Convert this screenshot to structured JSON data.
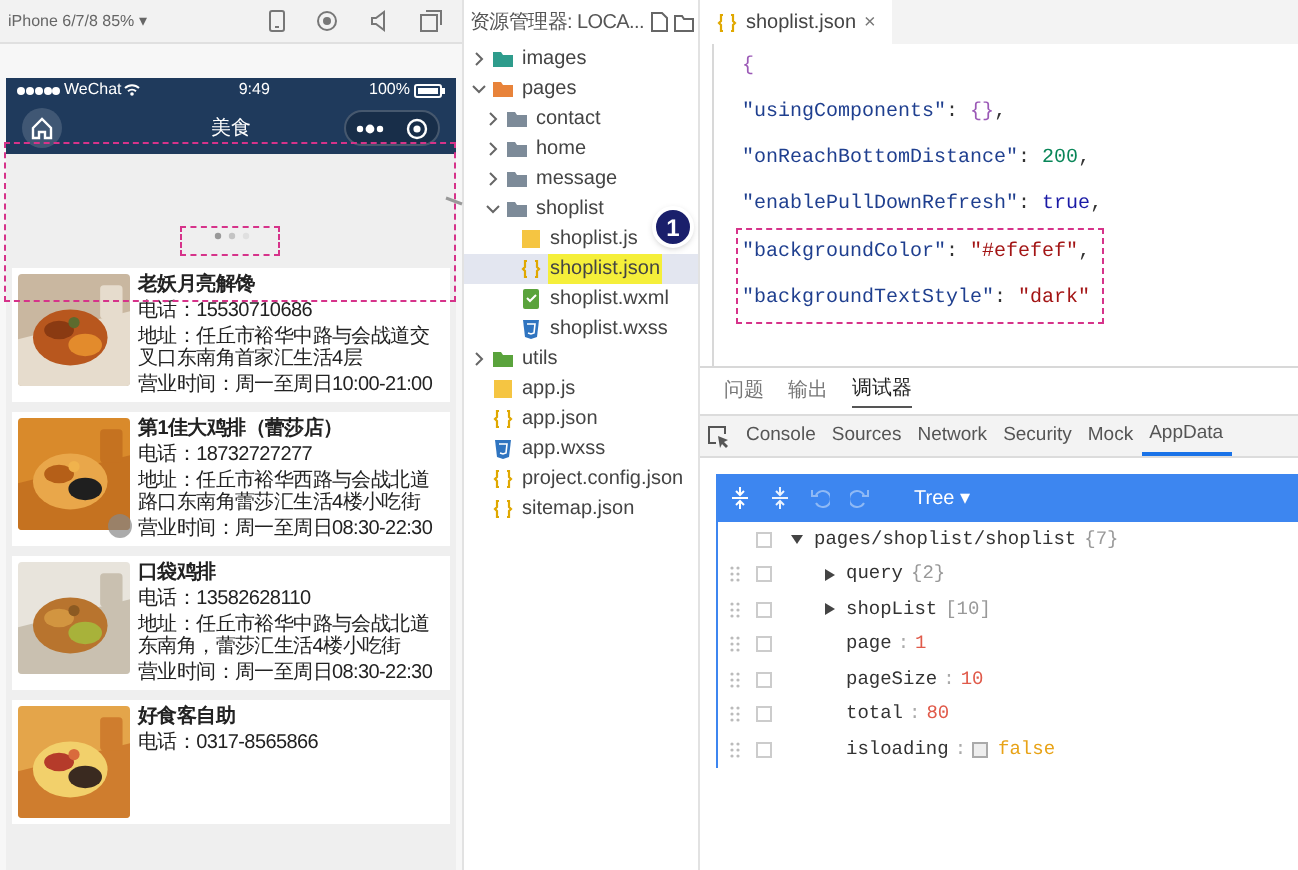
{
  "simulator": {
    "device": "iPhone 6/7/8 85% ▾",
    "status_bar": {
      "carrier": "WeChat",
      "time": "9:49",
      "battery": "100%"
    },
    "nav_title": "美食",
    "shops": [
      {
        "name": "老妖月亮解馋",
        "phone": "电话：15530710686",
        "address": "地址：任丘市裕华中路与会战道交叉口东南角首家汇生活4层",
        "hours": "营业时间：周一至周日10:00-21:00"
      },
      {
        "name": "第1佳大鸡排（蕾莎店）",
        "phone": "电话：18732727277",
        "address": "地址：任丘市裕华西路与会战北道路口东南角蕾莎汇生活4楼小吃街",
        "hours": "营业时间：周一至周日08:30-22:30"
      },
      {
        "name": "口袋鸡排",
        "phone": "电话：13582628110",
        "address": "地址：任丘市裕华中路与会战北道东南角，蕾莎汇生活4楼小吃街",
        "hours": "营业时间：周一至周日08:30-22:30"
      },
      {
        "name": "好食客自助",
        "phone": "电话：0317-8565866"
      }
    ]
  },
  "annotation_badge": "1",
  "explorer": {
    "title": "资源管理器: LOCA...",
    "items": [
      {
        "label": "images",
        "kind": "folder",
        "color": "#2e9c8c",
        "expanded": false,
        "selected": false
      },
      {
        "label": "pages",
        "kind": "folder",
        "color": "#e8833a",
        "expanded": true,
        "selected": false,
        "children": [
          {
            "label": "contact",
            "kind": "folder",
            "color": "#7d8b99",
            "expanded": false,
            "selected": false
          },
          {
            "label": "home",
            "kind": "folder",
            "color": "#7d8b99",
            "expanded": false,
            "selected": false
          },
          {
            "label": "message",
            "kind": "folder",
            "color": "#7d8b99",
            "expanded": false,
            "selected": false
          },
          {
            "label": "shoplist",
            "kind": "folder",
            "color": "#7d8b99",
            "expanded": true,
            "selected": false,
            "children": [
              {
                "label": "shoplist.js",
                "kind": "js",
                "selected": false
              },
              {
                "label": "shoplist.json",
                "kind": "json",
                "selected": true
              },
              {
                "label": "shoplist.wxml",
                "kind": "wxml",
                "selected": false
              },
              {
                "label": "shoplist.wxss",
                "kind": "wxss",
                "selected": false
              }
            ]
          }
        ]
      },
      {
        "label": "utils",
        "kind": "folder",
        "color": "#5aa33c",
        "expanded": false,
        "selected": false
      },
      {
        "label": "app.js",
        "kind": "js",
        "selected": false
      },
      {
        "label": "app.json",
        "kind": "json",
        "selected": false
      },
      {
        "label": "app.wxss",
        "kind": "wxss",
        "selected": false
      },
      {
        "label": "project.config.json",
        "kind": "json",
        "selected": false
      },
      {
        "label": "sitemap.json",
        "kind": "json",
        "selected": false
      }
    ]
  },
  "editor": {
    "tab": {
      "label": "shoplist.json",
      "close": "×"
    },
    "lines": [
      {
        "boxed": false,
        "tokens": [
          {
            "text": "{",
            "kind": "brace"
          }
        ]
      },
      {
        "boxed": false,
        "tokens": [
          {
            "text": "\"usingComponents\"",
            "kind": "key"
          },
          {
            "text": ": ",
            "kind": "punct"
          },
          {
            "text": "{}",
            "kind": "brace"
          },
          {
            "text": ",",
            "kind": "punct"
          }
        ]
      },
      {
        "boxed": false,
        "tokens": [
          {
            "text": "\"onReachBottomDistance\"",
            "kind": "key"
          },
          {
            "text": ": ",
            "kind": "punct"
          },
          {
            "text": "200",
            "kind": "number"
          },
          {
            "text": ",",
            "kind": "punct"
          }
        ]
      },
      {
        "boxed": false,
        "tokens": [
          {
            "text": "\"enablePullDownRefresh\"",
            "kind": "key"
          },
          {
            "text": ": ",
            "kind": "punct"
          },
          {
            "text": "true",
            "kind": "bool"
          },
          {
            "text": ",",
            "kind": "punct"
          }
        ]
      },
      {
        "boxed": true,
        "tokens": [
          {
            "text": "\"backgroundColor\"",
            "kind": "key"
          },
          {
            "text": ": ",
            "kind": "punct"
          },
          {
            "text": "\"#efefef\"",
            "kind": "string"
          },
          {
            "text": ",",
            "kind": "punct"
          }
        ]
      },
      {
        "boxed": true,
        "tokens": [
          {
            "text": "\"backgroundTextStyle\"",
            "kind": "key"
          },
          {
            "text": ": ",
            "kind": "punct"
          },
          {
            "text": "\"dark\"",
            "kind": "string"
          }
        ]
      }
    ]
  },
  "debug": {
    "panel_tabs": [
      {
        "label": "问题",
        "selected": false
      },
      {
        "label": "输出",
        "selected": false
      },
      {
        "label": "调试器",
        "selected": true
      }
    ],
    "devtools_tabs": [
      {
        "label": "Console",
        "selected": false
      },
      {
        "label": "Sources",
        "selected": false
      },
      {
        "label": "Network",
        "selected": false
      },
      {
        "label": "Security",
        "selected": false
      },
      {
        "label": "Mock",
        "selected": false
      },
      {
        "label": "AppData",
        "selected": true
      }
    ],
    "appdata": {
      "mode": "Tree ▾",
      "root": {
        "key": "pages/shoplist/shoplist",
        "kind": "object",
        "summary": "{7}",
        "expanded": true,
        "checked": false,
        "children": [
          {
            "key": "query",
            "kind": "object",
            "summary": "{2}",
            "expanded": false,
            "checked": false
          },
          {
            "key": "shopList",
            "kind": "object",
            "summary": "[10]",
            "expanded": false,
            "checked": false
          },
          {
            "key": "page",
            "kind": "number",
            "sep": ":",
            "value": "1",
            "checked": false
          },
          {
            "key": "pageSize",
            "kind": "number",
            "sep": ":",
            "value": "10",
            "checked": false
          },
          {
            "key": "total",
            "kind": "number",
            "sep": ":",
            "value": "80",
            "checked": false
          },
          {
            "key": "isloading",
            "kind": "boolean",
            "sep": ":",
            "value": "false",
            "checked": false,
            "value_checked": false
          }
        ]
      }
    }
  }
}
